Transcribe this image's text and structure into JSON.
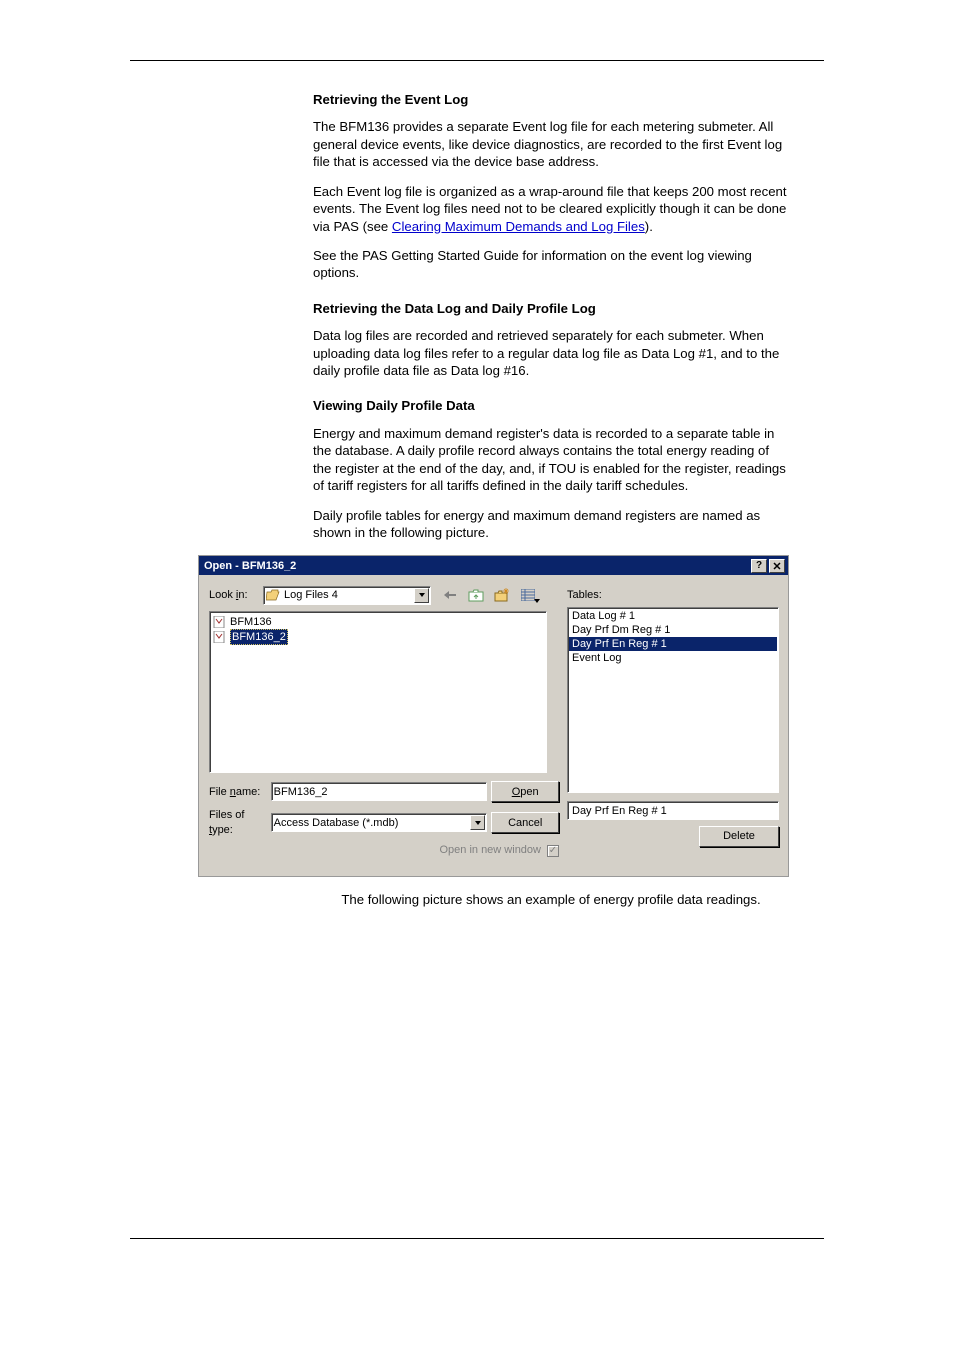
{
  "headings": {
    "h1": "Retrieving the Event Log",
    "h2": "Retrieving the Data Log and Daily Profile Log",
    "h3": "Viewing Daily Profile Data"
  },
  "paragraphs": {
    "p1": "The BFM136 provides a separate Event log file for each metering submeter. All general device events, like device diagnostics, are recorded to the first Event log file that is accessed via the device base address.",
    "p2a": "Each Event log file is organized as a wrap-around file that keeps 200 most recent events. The Event log files need not to be cleared explicitly though it can be done via PAS (see ",
    "p2link": "Clearing Maximum Demands and Log Files",
    "p2b": ").",
    "p3": "See the PAS Getting Started Guide for information on the event log viewing options.",
    "p4": "Data log files are recorded and retrieved separately for each submeter. When uploading data log files refer to a regular data log file as Data Log #1, and to the daily profile data file as Data log #16.",
    "p5": "Energy and maximum demand register's data is recorded to a separate table in the database. A daily profile record always contains the total energy reading of the register at the end of the day, and, if TOU is enabled for the register, readings of tariff registers for all tariffs defined in the daily tariff schedules.",
    "p6": "Daily profile tables for energy and maximum demand registers are named as shown in the following picture.",
    "p7": "The following picture shows an example of energy profile data readings."
  },
  "dialog": {
    "title": "Open - BFM136_2",
    "lookin_label_pre": "Look ",
    "lookin_label_ul": "i",
    "lookin_label_post": "n:",
    "lookin_value": "Log Files 4",
    "files": [
      {
        "name": "BFM136",
        "selected": false
      },
      {
        "name": "BFM136_2",
        "selected": true
      }
    ],
    "filename_label_pre": "File ",
    "filename_label_ul": "n",
    "filename_label_post": "ame:",
    "filename_value": "BFM136_2",
    "filetype_label_pre": "Files of ",
    "filetype_label_ul": "t",
    "filetype_label_post": "ype:",
    "filetype_value": "Access Database (*.mdb)",
    "open_btn_ul": "O",
    "open_btn_rest": "pen",
    "cancel_btn": "Cancel",
    "open_new_window": "Open in new window",
    "tables_label": "Tables:",
    "tables": [
      {
        "name": "Data Log # 1",
        "selected": false
      },
      {
        "name": "Day Prf Dm Reg # 1",
        "selected": false
      },
      {
        "name": "Day Prf En Reg # 1",
        "selected": true
      },
      {
        "name": "Event Log",
        "selected": false
      }
    ],
    "selected_table": "Day Prf En Reg # 1",
    "delete_btn": "Delete"
  }
}
